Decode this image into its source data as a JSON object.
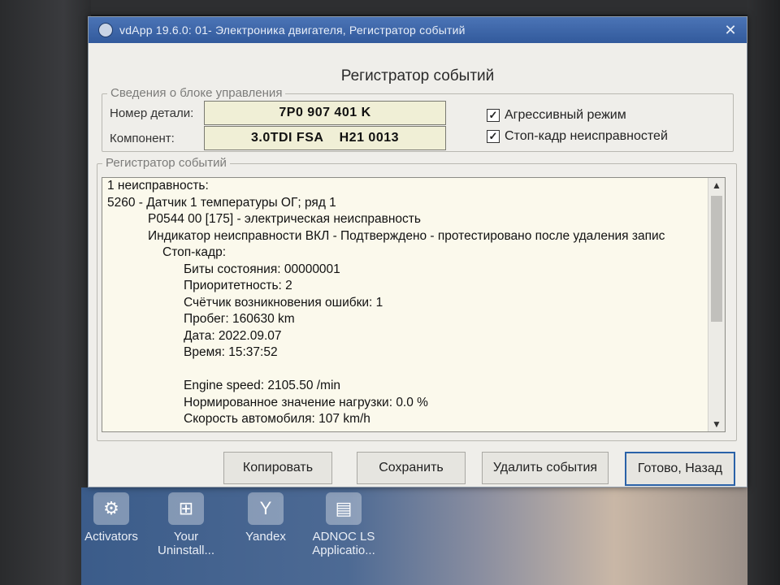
{
  "window": {
    "title": "vdApp 19.6.0: 01- Электроника двигателя,  Регистратор событий",
    "close_glyph": "✕",
    "heading": "Регистратор событий"
  },
  "control_unit": {
    "legend": "Сведения о блоке управления",
    "part_label": "Номер детали:",
    "part_value": "7P0 907 401 K",
    "component_label": "Компонент:",
    "component_value": "3.0TDI FSA    H21 0013"
  },
  "options": {
    "aggressive": {
      "label": "Агрессивный режим",
      "checked": true,
      "mark": "✓"
    },
    "freeze_frame": {
      "label": "Стоп-кадр неисправностей",
      "checked": true,
      "mark": "✓"
    }
  },
  "log": {
    "legend": "Регистратор событий",
    "lines": [
      {
        "indent": 0,
        "text": "1 неисправность:"
      },
      {
        "indent": 0,
        "text": "5260 - Датчик 1 температуры ОГ; ряд 1"
      },
      {
        "indent": 1,
        "text": "P0544 00 [175] - электрическая неисправность"
      },
      {
        "indent": 1,
        "text": "Индикатор неисправности ВКЛ - Подтверждено - протестировано после удаления запис"
      },
      {
        "indent": 2,
        "text": "Стоп-кадр:"
      },
      {
        "indent": 3,
        "text": "Биты состояния: 00000001"
      },
      {
        "indent": 3,
        "text": "Приоритетность: 2"
      },
      {
        "indent": 3,
        "text": "Счётчик возникновения ошибки: 1"
      },
      {
        "indent": 3,
        "text": "Пробег: 160630 km"
      },
      {
        "indent": 3,
        "text": "Дата: 2022.09.07"
      },
      {
        "indent": 3,
        "text": "Время: 15:37:52"
      },
      {
        "indent": 3,
        "text": ""
      },
      {
        "indent": 3,
        "text": "Engine speed: 2105.50 /min"
      },
      {
        "indent": 3,
        "text": "Нормированное значение нагрузки: 0.0 %"
      },
      {
        "indent": 3,
        "text": "Скорость автомобиля: 107 km/h"
      }
    ],
    "scroll_up": "▲",
    "scroll_down": "▼"
  },
  "buttons": {
    "copy": "Копировать",
    "save": "Сохранить",
    "delete": "Удалить события",
    "done": "Готово, Назад"
  },
  "desktop_icons": [
    {
      "label": "Activators",
      "glyph": "⚙"
    },
    {
      "label": "Your Uninstall...",
      "glyph": "⊞"
    },
    {
      "label": "Yandex",
      "glyph": "Y"
    },
    {
      "label": "ADNOC LS Applicatio...",
      "glyph": "▤"
    }
  ]
}
